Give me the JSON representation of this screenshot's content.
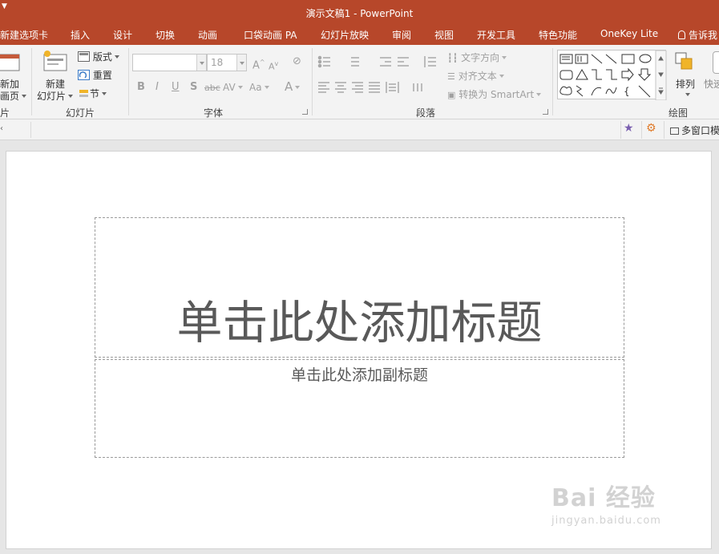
{
  "window": {
    "title": "演示文稿1 - PowerPoint"
  },
  "tabs": [
    {
      "id": "new-tab",
      "label": "新建选项卡"
    },
    {
      "id": "insert",
      "label": "插入"
    },
    {
      "id": "design",
      "label": "设计"
    },
    {
      "id": "transitions",
      "label": "切换"
    },
    {
      "id": "animations",
      "label": "动画"
    },
    {
      "id": "pocket-animation",
      "label": "口袋动画 PA"
    },
    {
      "id": "slideshow",
      "label": "幻灯片放映"
    },
    {
      "id": "review",
      "label": "审阅"
    },
    {
      "id": "view",
      "label": "视图"
    },
    {
      "id": "developer",
      "label": "开发工具"
    },
    {
      "id": "features",
      "label": "特色功能"
    },
    {
      "id": "onekey",
      "label": "OneKey Lite"
    }
  ],
  "tell_me": "告诉我",
  "ribbon": {
    "slides_group": {
      "label": "幻灯片",
      "left_partial_top": "新加",
      "left_partial_bottom": "画页",
      "left_group_partial": "片",
      "new_slide_top": "新建",
      "new_slide_bottom": "幻灯片",
      "layout": "版式",
      "reset": "重置",
      "section": "节"
    },
    "font_group": {
      "label": "字体",
      "font_name": "",
      "font_size": "18",
      "bold": "B",
      "italic": "I",
      "underline": "U",
      "shadow": "S",
      "strike": "abc",
      "spacing": "AV",
      "case": "Aa",
      "color": "A",
      "grow": "A",
      "shrink": "A"
    },
    "paragraph_group": {
      "label": "段落",
      "text_direction": "文字方向",
      "align_text": "对齐文本",
      "convert_smartart": "转换为 SmartArt"
    },
    "drawing_group": {
      "label": "绘图",
      "arrange": "排列",
      "quick_partial": "快速"
    }
  },
  "subbar": {
    "multi_window": "多窗口模"
  },
  "slide": {
    "title_placeholder": "单击此处添加标题",
    "subtitle_placeholder": "单击此处添加副标题"
  },
  "watermark": {
    "brand": "Bai 经验",
    "url": "jingyan.baidu.com"
  },
  "colors": {
    "accent": "#b7472a",
    "ribbon_bg": "#f3f3f3",
    "canvas_bg": "#e6e6e6"
  }
}
